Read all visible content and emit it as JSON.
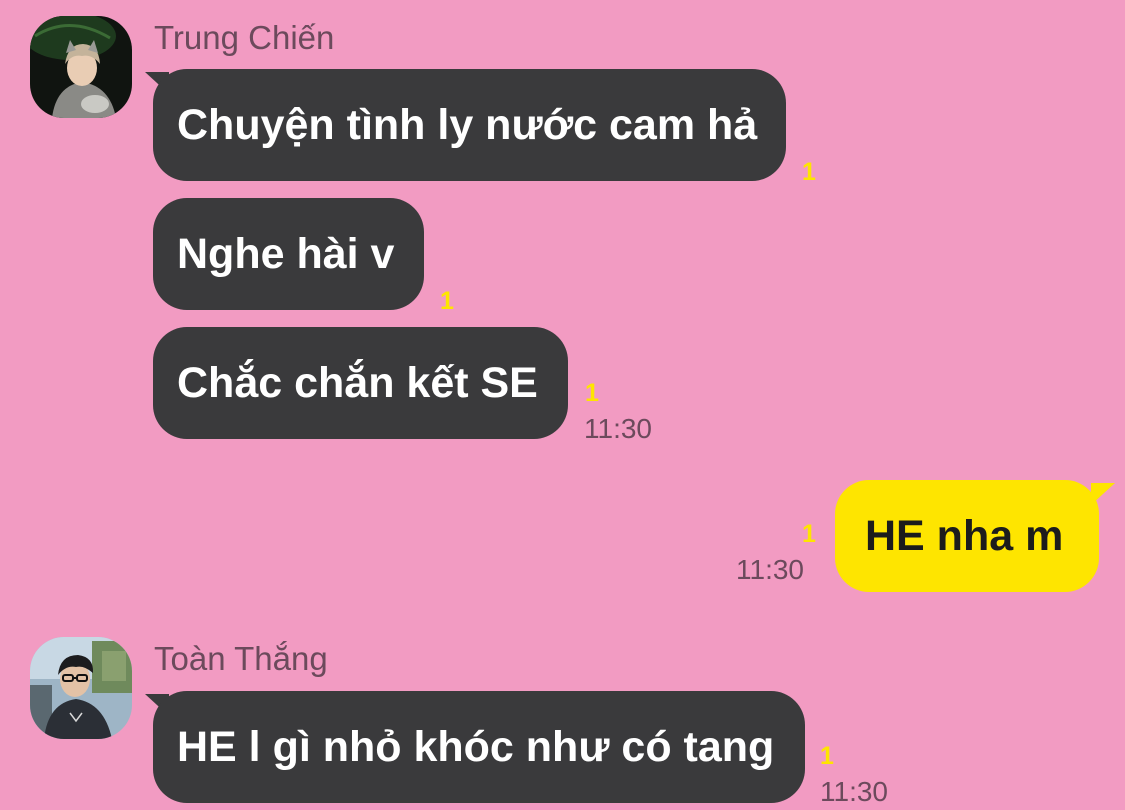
{
  "messages": {
    "group1": {
      "sender": "Trung Chiến",
      "bubbles": [
        {
          "text": "Chuyện tình ly nước cam hả",
          "unread": "1"
        },
        {
          "text": "Nghe hài v",
          "unread": "1"
        },
        {
          "text": "Chắc chắn kết SE",
          "unread": "1",
          "time": "11:30"
        }
      ]
    },
    "outgoing": {
      "text": "HE nha m",
      "unread": "1",
      "time": "11:30"
    },
    "group2": {
      "sender": "Toàn Thắng",
      "bubbles": [
        {
          "text": "HE l gì nhỏ khóc như có tang",
          "unread": "1",
          "time": "11:30"
        }
      ]
    }
  },
  "colors": {
    "background": "#f29bc2",
    "incoming_bubble": "#3a3a3c",
    "outgoing_bubble": "#fee500",
    "unread_count": "#fee500",
    "meta_text": "#6c4a5c"
  },
  "icons": {
    "avatar1": "user-avatar-photo",
    "avatar2": "user-avatar-photo"
  }
}
